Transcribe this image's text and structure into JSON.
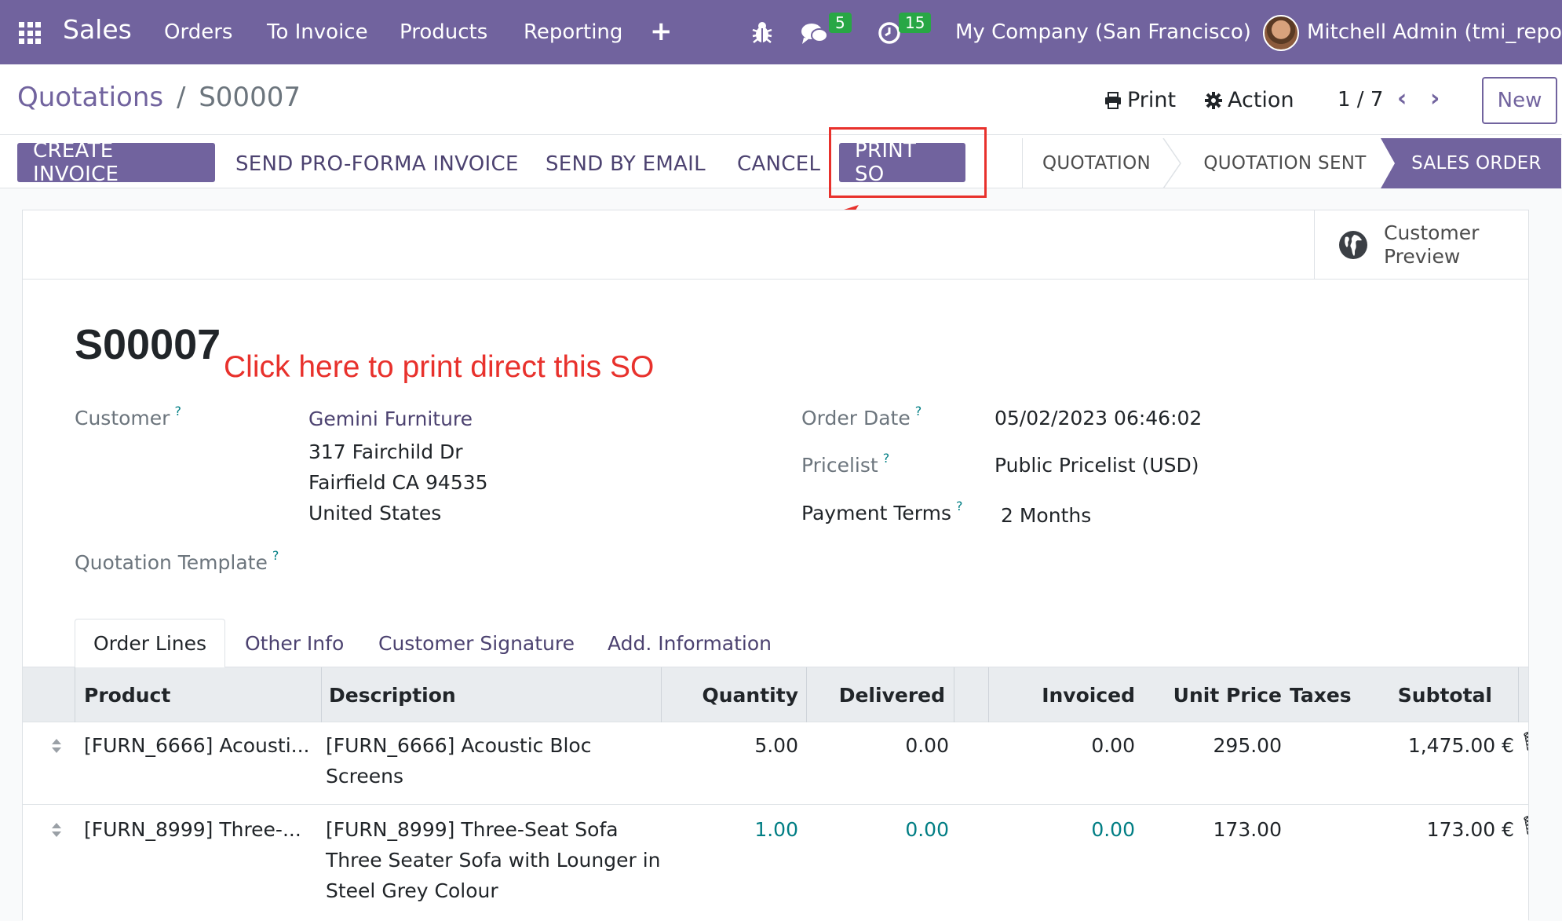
{
  "navbar": {
    "app_name": "Sales",
    "menu": [
      "Orders",
      "To Invoice",
      "Products",
      "Reporting"
    ],
    "plus": "+",
    "messages_count": "5",
    "activities_count": "15",
    "company": "My Company (San Francisco)",
    "user": "Mitchell Admin (tmi_report)"
  },
  "control_panel": {
    "breadcrumb_parent": "Quotations",
    "breadcrumb_sep": "/",
    "breadcrumb_current": "S00007",
    "print_label": "Print",
    "action_label": "Action",
    "pager": "1 / 7",
    "new_label": "New"
  },
  "actions": {
    "create_invoice": "CREATE INVOICE",
    "send_proforma": "SEND PRO-FORMA INVOICE",
    "send_email": "SEND BY EMAIL",
    "cancel": "CANCEL",
    "print_so": "PRINT SO"
  },
  "stages": [
    "QUOTATION",
    "QUOTATION SENT",
    "SALES ORDER"
  ],
  "active_stage": "SALES ORDER",
  "preview": {
    "line1": "Customer",
    "line2": "Preview"
  },
  "annotation": "Click here to print direct this SO",
  "form": {
    "name": "S00007",
    "customer_label": "Customer",
    "customer_name": "Gemini Furniture",
    "address": [
      "317 Fairchild Dr",
      "Fairfield CA 94535",
      "United States"
    ],
    "template_label": "Quotation Template",
    "order_date_label": "Order Date",
    "order_date": "05/02/2023 06:46:02",
    "pricelist_label": "Pricelist",
    "pricelist": "Public Pricelist (USD)",
    "payment_terms_label": "Payment Terms",
    "payment_terms": "2 Months",
    "help_mark": "?"
  },
  "tabs": [
    "Order Lines",
    "Other Info",
    "Customer Signature",
    "Add. Information"
  ],
  "table": {
    "headers": [
      "Product",
      "Description",
      "Quantity",
      "Delivered",
      "Invoiced",
      "Unit Price",
      "Taxes",
      "Subtotal"
    ],
    "rows": [
      {
        "product": "[FURN_6666] Acousti...",
        "description": [
          "[FURN_6666] Acoustic Bloc",
          "Screens"
        ],
        "quantity": "5.00",
        "delivered": "0.00",
        "invoiced": "0.00",
        "unit_price": "295.00",
        "taxes": "",
        "subtotal": "1,475.00 €"
      },
      {
        "product": "[FURN_8999] Three-...",
        "description": [
          "[FURN_8999] Three-Seat Sofa",
          "Three Seater Sofa with Lounger in",
          "Steel Grey Colour"
        ],
        "quantity": "1.00",
        "delivered": "0.00",
        "invoiced": "0.00",
        "unit_price": "173.00",
        "taxes": "",
        "subtotal": "173.00 €"
      }
    ]
  },
  "colors": {
    "brand": "#71639e",
    "annotation": "#e8312c",
    "teal": "#017e84",
    "badge": "#28a745"
  }
}
